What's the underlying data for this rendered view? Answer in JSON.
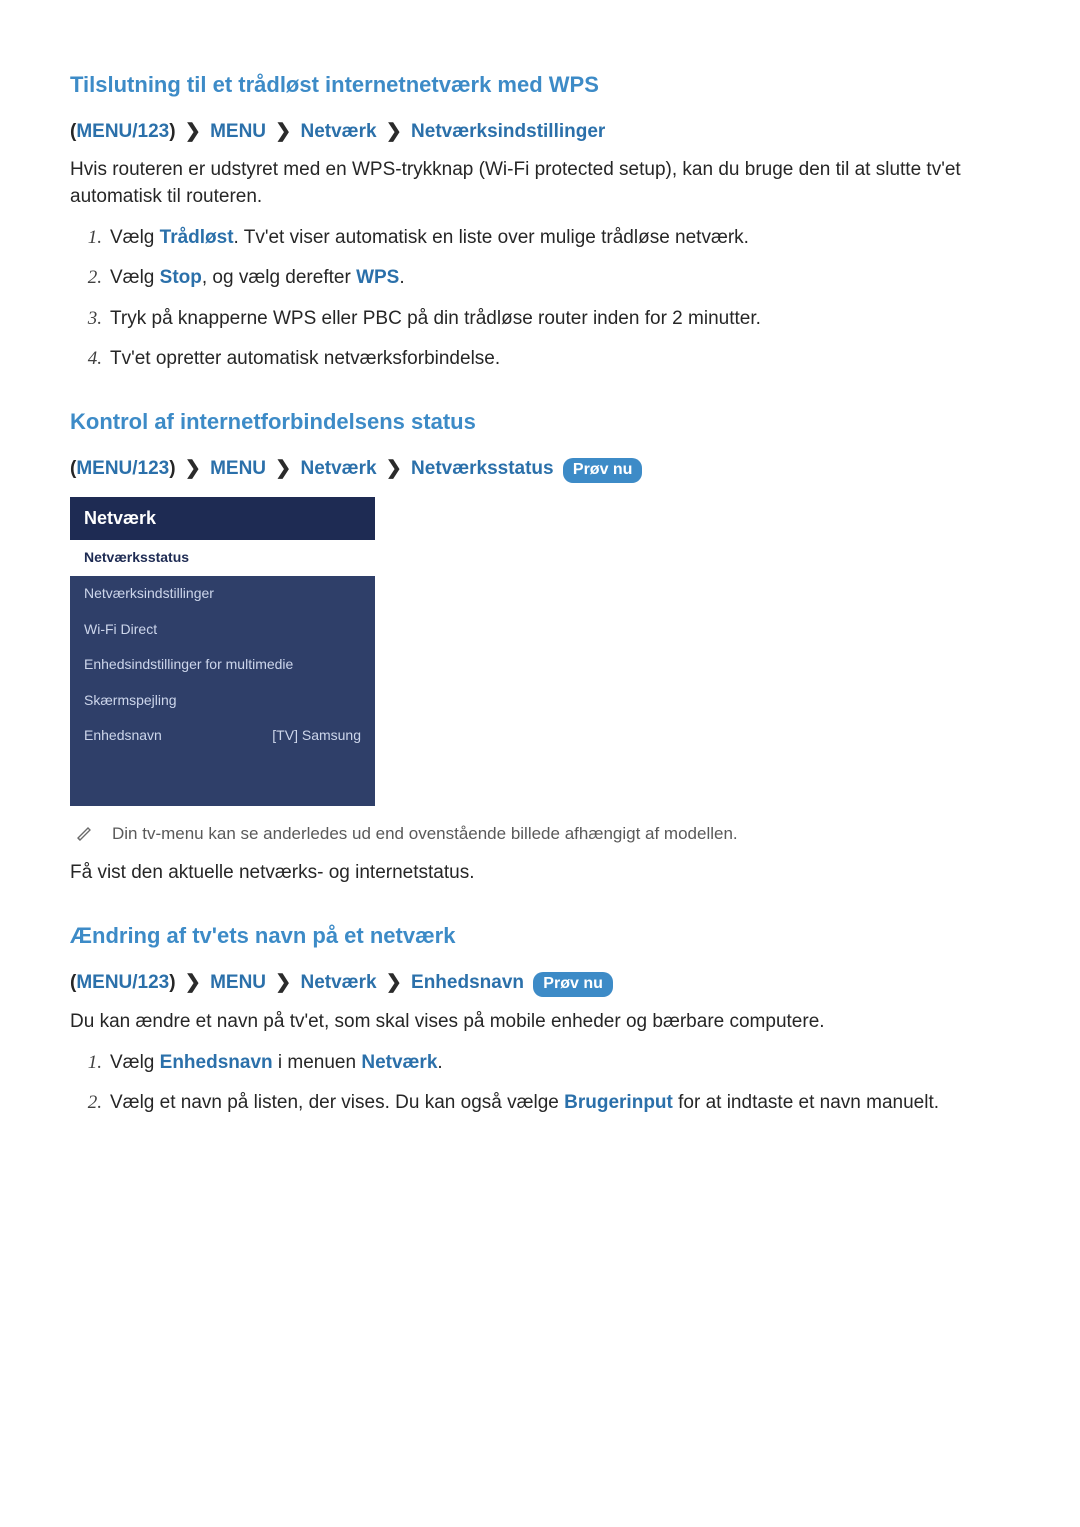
{
  "section1": {
    "title": "Tilslutning til et trådløst internetnetværk med WPS",
    "breadcrumb": {
      "root": "MENU/123",
      "levels": [
        "MENU",
        "Netværk",
        "Netværksindstillinger"
      ]
    },
    "intro": "Hvis routeren er udstyret med en WPS-trykknap (Wi-Fi protected setup), kan du bruge den til at slutte tv'et automatisk til routeren.",
    "step1_a": "Vælg ",
    "step1_k": "Trådløst",
    "step1_b": ". Tv'et viser automatisk en liste over mulige trådløse netværk.",
    "step2_a": "Vælg ",
    "step2_k1": "Stop",
    "step2_mid": ", og vælg derefter ",
    "step2_k2": "WPS",
    "step2_end": ".",
    "step3": "Tryk på knapperne WPS eller PBC på din trådløse router inden for 2 minutter.",
    "step4": "Tv'et opretter automatisk netværksforbindelse."
  },
  "section2": {
    "title": "Kontrol af internetforbindelsens status",
    "breadcrumb": {
      "root": "MENU/123",
      "levels": [
        "MENU",
        "Netværk",
        "Netværksstatus"
      ],
      "badge": "Prøv nu"
    },
    "menu": {
      "header": "Netværk",
      "items": [
        {
          "label": "Netværksstatus",
          "value": "",
          "selected": true
        },
        {
          "label": "Netværksindstillinger",
          "value": "",
          "selected": false
        },
        {
          "label": "Wi-Fi Direct",
          "value": "",
          "selected": false
        },
        {
          "label": "Enhedsindstillinger for multimedie",
          "value": "",
          "selected": false
        },
        {
          "label": "Skærmspejling",
          "value": "",
          "selected": false
        },
        {
          "label": "Enhedsnavn",
          "value": "[TV] Samsung",
          "selected": false
        }
      ]
    },
    "note": "Din tv-menu kan se anderledes ud end ovenstående billede afhængigt af modellen.",
    "body": "Få vist den aktuelle netværks- og internetstatus."
  },
  "section3": {
    "title": "Ændring af tv'ets navn på et netværk",
    "breadcrumb": {
      "root": "MENU/123",
      "levels": [
        "MENU",
        "Netværk",
        "Enhedsnavn"
      ],
      "badge": "Prøv nu"
    },
    "intro": "Du kan ændre et navn på tv'et, som skal vises på mobile enheder og bærbare computere.",
    "step1_a": "Vælg ",
    "step1_k1": "Enhedsnavn",
    "step1_mid": " i menuen ",
    "step1_k2": "Netværk",
    "step1_end": ".",
    "step2_a": "Vælg et navn på listen, der vises. Du kan også vælge ",
    "step2_k": "Brugerinput",
    "step2_b": " for at indtaste et navn manuelt."
  }
}
